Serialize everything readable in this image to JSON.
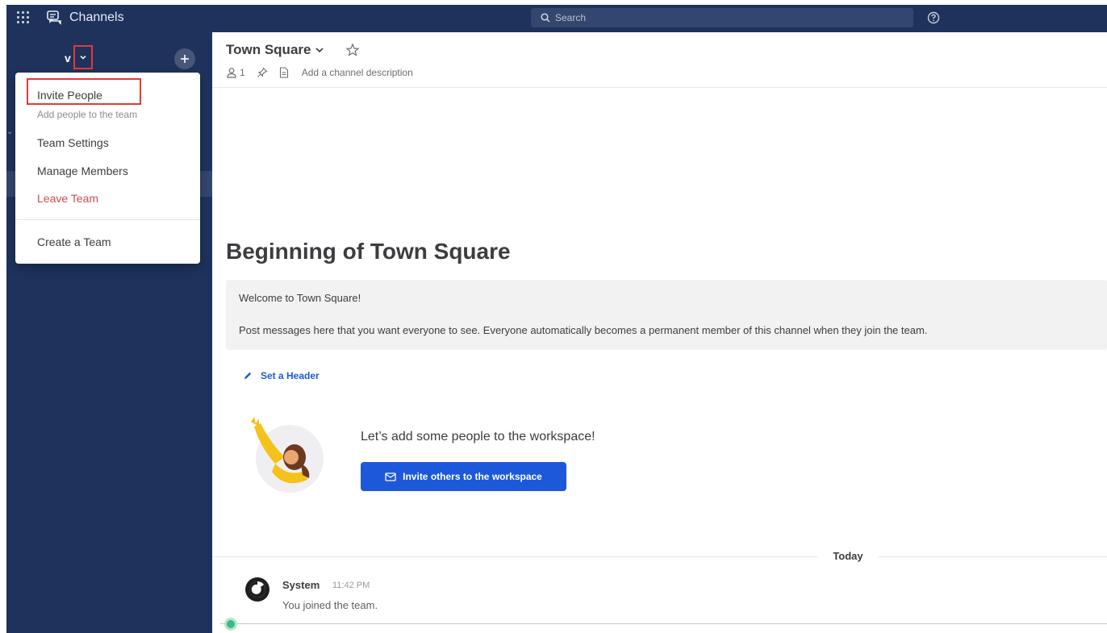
{
  "topbar": {
    "product_name": "Channels",
    "search_placeholder": "Search"
  },
  "sidebar": {
    "team_name": "v",
    "collapse_glyph": "⌄"
  },
  "team_menu": {
    "invite_people": "Invite People",
    "invite_people_sub": "Add people to the team",
    "team_settings": "Team Settings",
    "manage_members": "Manage Members",
    "leave_team": "Leave Team",
    "create_team": "Create a Team"
  },
  "channel": {
    "title": "Town Square",
    "member_count": "1",
    "description_placeholder": "Add a channel description"
  },
  "intro": {
    "title": "Beginning of Town Square",
    "welcome_title": "Welcome to Town Square!",
    "welcome_body": "Post messages here that you want everyone to see. Everyone automatically becomes a permanent member of this channel when they join the team.",
    "set_header": "Set a Header",
    "add_people": "Let’s add some people to the workspace!",
    "invite_button": "Invite others to the workspace"
  },
  "posts": {
    "date_separator": "Today",
    "items": [
      {
        "author": "System",
        "time": "11:42 PM",
        "message": "You joined the team."
      }
    ]
  },
  "colors": {
    "sidebar_bg": "#1e325c",
    "accent_blue": "#1c58d9",
    "danger_red": "#d24b4e",
    "highlight_red": "#e53935",
    "online_green": "#3db887"
  },
  "icons": [
    "grid-icon",
    "channels-icon",
    "search-icon",
    "help-icon",
    "chevron-down-icon",
    "plus-icon",
    "star-icon",
    "member-icon",
    "pin-icon",
    "file-icon",
    "pencil-icon",
    "envelope-icon",
    "mattermost-logo-icon"
  ]
}
